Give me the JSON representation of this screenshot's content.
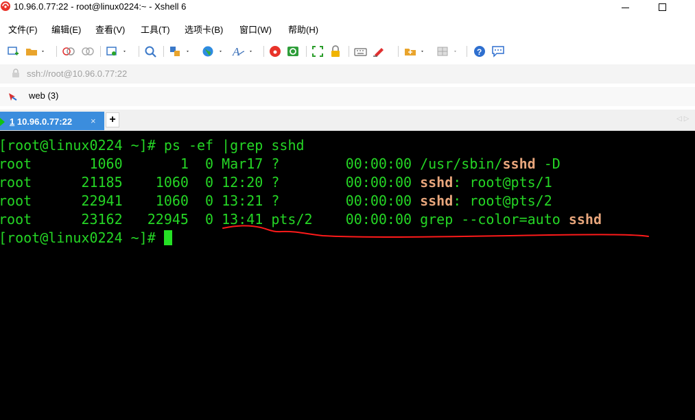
{
  "window": {
    "title": "10.96.0.77:22 - root@linux0224:~ - Xshell 6"
  },
  "menu": {
    "items": [
      "文件(F)",
      "编辑(E)",
      "查看(V)",
      "工具(T)",
      "选项卡(B)",
      "窗口(W)",
      "帮助(H)"
    ]
  },
  "address": {
    "text": "ssh://root@10.96.0.77:22"
  },
  "links": {
    "label": "web (3)"
  },
  "tabs": {
    "active_number": "1",
    "active_label": " 10.96.0.77:22",
    "close_glyph": "×",
    "add_glyph": "+",
    "nav_glyphs": "◁▷"
  },
  "terminal": {
    "colors": {
      "text": "#25d625",
      "highlight": "#e8a67c",
      "background": "#000000",
      "annotation": "#ff1a1a"
    },
    "prompt": "[root@linux0224 ~]# ",
    "command": "ps -ef |grep sshd",
    "rows": [
      {
        "prefix": "root       1060       1  0 Mar17 ?        00:00:00 /usr/sbin/",
        "match": "sshd",
        "suffix": " -D"
      },
      {
        "prefix": "root      21185    1060  0 12:20 ?        00:00:00 ",
        "match": "sshd",
        "suffix": ": root@pts/1"
      },
      {
        "prefix": "root      22941    1060  0 13:21 ?        00:00:00 ",
        "match": "sshd",
        "suffix": ": root@pts/2"
      },
      {
        "prefix": "root      23162   22945  0 13:41 pts/2    00:00:00 grep --color=auto ",
        "match": "sshd",
        "suffix": ""
      }
    ],
    "final_prompt": "[root@linux0224 ~]# "
  }
}
